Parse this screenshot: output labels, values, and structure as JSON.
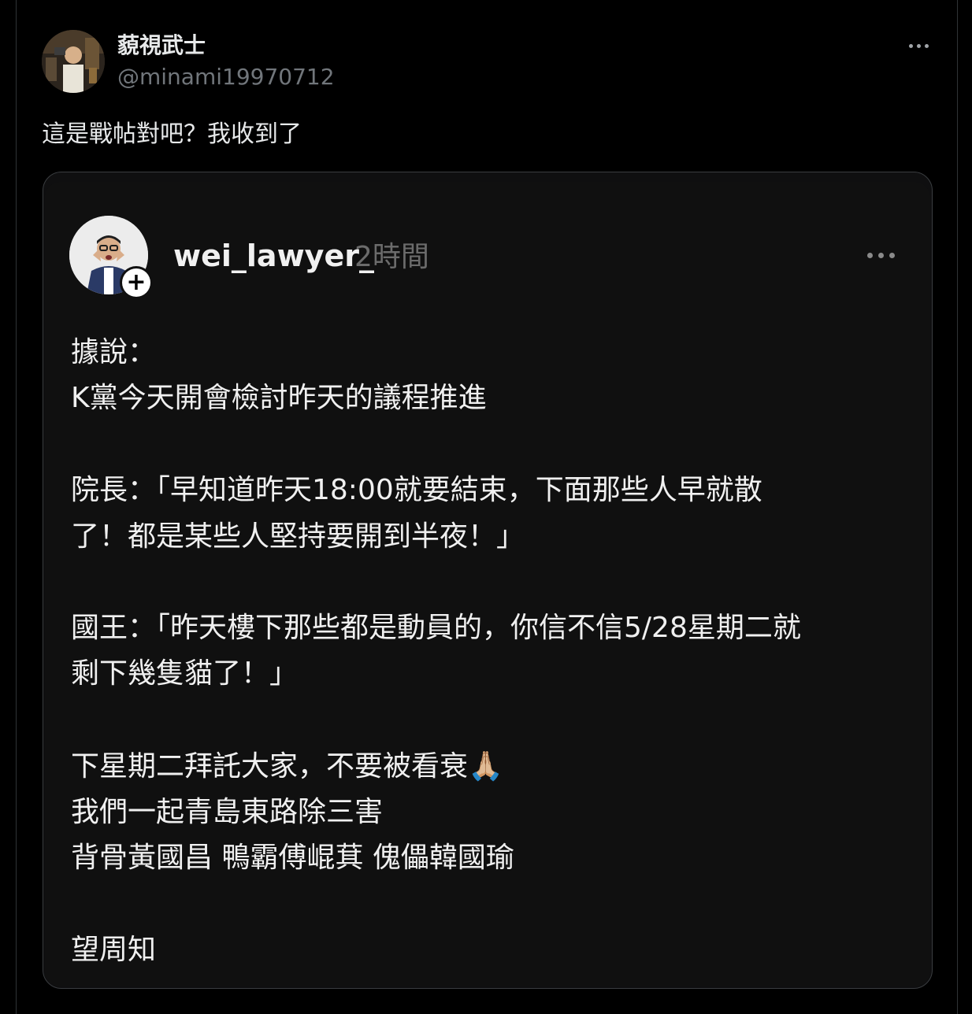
{
  "post": {
    "author": {
      "display_name": "藐視武士",
      "handle": "@minami19970712"
    },
    "text": "這是戰帖對吧？我收到了",
    "more_icon": "more-horizontal-icon"
  },
  "embedded": {
    "username": "wei_lawyer_",
    "time": "2時間",
    "follow_icon": "plus-icon",
    "follow_symbol": "+",
    "more_icon": "more-horizontal-icon",
    "lines": [
      "據說：",
      "K黨今天開會檢討昨天的議程推進",
      "院長：「早知道昨天18:00就要結束，下面那些人早就散",
      "了！都是某些人堅持要開到半夜！」",
      "國王：「昨天樓下那些都是動員的，你信不信5/28星期二就",
      "剩下幾隻貓了！」",
      "下星期二拜託大家，不要被看衰🙏🏼",
      "我們一起青島東路除三害",
      "背骨黃國昌  鴨霸傅崐萁  傀儡韓國瑜",
      "望周知"
    ]
  },
  "colors": {
    "background": "#000000",
    "primary_text": "#e7e9ea",
    "secondary_text": "#71767b",
    "card_background": "#101010",
    "card_border": "#3a3d40"
  }
}
